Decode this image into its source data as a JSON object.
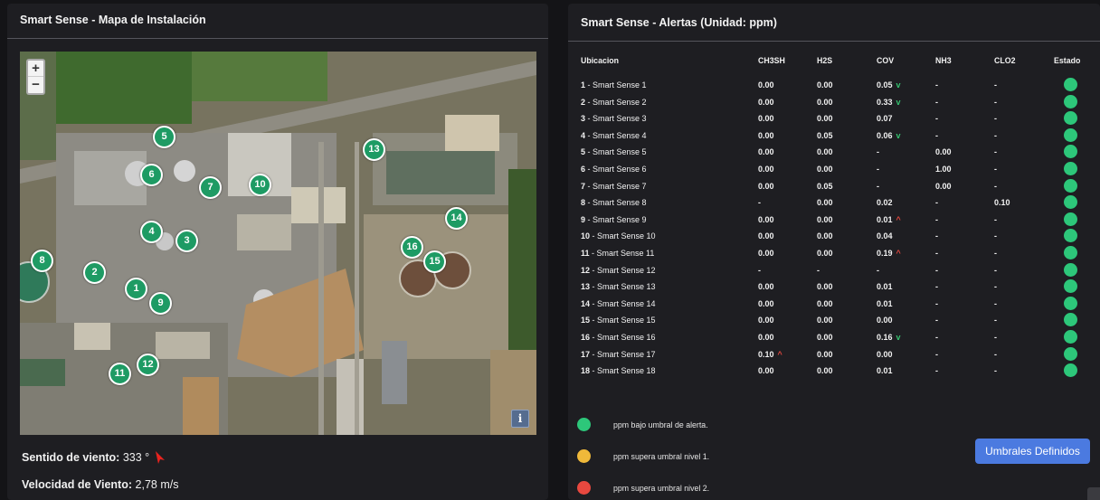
{
  "map_panel": {
    "title": "Smart Sense - Mapa de Instalación",
    "zoom_in": "+",
    "zoom_out": "−",
    "info": "i",
    "markers": [
      "1",
      "2",
      "3",
      "4",
      "5",
      "6",
      "7",
      "8",
      "9",
      "10",
      "11",
      "12",
      "13",
      "14",
      "15",
      "16"
    ],
    "wind_dir_label": "Sentido de viento:",
    "wind_dir_value": "333 °",
    "wind_speed_label": "Velocidad de Viento:",
    "wind_speed_value": "2,78 m/s",
    "wind_arrow_color": "#e8231e"
  },
  "alerts_panel": {
    "title": "Smart Sense - Alertas (Unidad: ppm)",
    "headers": [
      "Ubicacion",
      "CH3SH",
      "H2S",
      "COV",
      "NH3",
      "CLO2",
      "Estado"
    ],
    "rows": [
      {
        "num": "1",
        "name": " - Smart Sense 1",
        "ch3sh": "0.00",
        "h2s": "0.00",
        "cov": "0.05",
        "cov_trend": "v",
        "nh3": "-",
        "clo2": "-"
      },
      {
        "num": "2",
        "name": " - Smart Sense 2",
        "ch3sh": "0.00",
        "h2s": "0.00",
        "cov": "0.33",
        "cov_trend": "v",
        "nh3": "-",
        "clo2": "-"
      },
      {
        "num": "3",
        "name": " - Smart Sense 3",
        "ch3sh": "0.00",
        "h2s": "0.00",
        "cov": "0.07",
        "cov_trend": "",
        "nh3": "-",
        "clo2": "-"
      },
      {
        "num": "4",
        "name": " - Smart Sense 4",
        "ch3sh": "0.00",
        "h2s": "0.05",
        "cov": "0.06",
        "cov_trend": "v",
        "nh3": "-",
        "clo2": "-"
      },
      {
        "num": "5",
        "name": " - Smart Sense 5",
        "ch3sh": "0.00",
        "h2s": "0.00",
        "cov": "-",
        "cov_trend": "",
        "nh3": "0.00",
        "clo2": "-"
      },
      {
        "num": "6",
        "name": " - Smart Sense 6",
        "ch3sh": "0.00",
        "h2s": "0.00",
        "cov": "-",
        "cov_trend": "",
        "nh3": "1.00",
        "clo2": "-"
      },
      {
        "num": "7",
        "name": " - Smart Sense 7",
        "ch3sh": "0.00",
        "h2s": "0.05",
        "cov": "-",
        "cov_trend": "",
        "nh3": "0.00",
        "clo2": "-"
      },
      {
        "num": "8",
        "name": " - Smart Sense 8",
        "ch3sh": "-",
        "h2s": "0.00",
        "cov": "0.02",
        "cov_trend": "",
        "nh3": "-",
        "clo2": "0.10"
      },
      {
        "num": "9",
        "name": " - Smart Sense 9",
        "ch3sh": "0.00",
        "h2s": "0.00",
        "cov": "0.01",
        "cov_trend": "^",
        "nh3": "-",
        "clo2": "-"
      },
      {
        "num": "10",
        "name": " - Smart Sense 10",
        "ch3sh": "0.00",
        "h2s": "0.00",
        "cov": "0.04",
        "cov_trend": "",
        "nh3": "-",
        "clo2": "-"
      },
      {
        "num": "11",
        "name": " - Smart Sense 11",
        "ch3sh": "0.00",
        "h2s": "0.00",
        "cov": "0.19",
        "cov_trend": "^",
        "nh3": "-",
        "clo2": "-"
      },
      {
        "num": "12",
        "name": " - Smart Sense 12",
        "ch3sh": "-",
        "h2s": "-",
        "cov": "-",
        "cov_trend": "",
        "nh3": "-",
        "clo2": "-"
      },
      {
        "num": "13",
        "name": " - Smart Sense 13",
        "ch3sh": "0.00",
        "h2s": "0.00",
        "cov": "0.01",
        "cov_trend": "",
        "nh3": "-",
        "clo2": "-"
      },
      {
        "num": "14",
        "name": " - Smart Sense 14",
        "ch3sh": "0.00",
        "h2s": "0.00",
        "cov": "0.01",
        "cov_trend": "",
        "nh3": "-",
        "clo2": "-"
      },
      {
        "num": "15",
        "name": " - Smart Sense 15",
        "ch3sh": "0.00",
        "h2s": "0.00",
        "cov": "0.00",
        "cov_trend": "",
        "nh3": "-",
        "clo2": "-"
      },
      {
        "num": "16",
        "name": " - Smart Sense 16",
        "ch3sh": "0.00",
        "h2s": "0.00",
        "cov": "0.16",
        "cov_trend": "v",
        "nh3": "-",
        "clo2": "-"
      },
      {
        "num": "17",
        "name": " - Smart Sense 17",
        "ch3sh": "0.10",
        "ch3sh_trend": "^",
        "h2s": "0.00",
        "cov": "0.00",
        "cov_trend": "",
        "nh3": "-",
        "clo2": "-"
      },
      {
        "num": "18",
        "name": " - Smart Sense 18",
        "ch3sh": "0.00",
        "h2s": "0.00",
        "cov": "0.01",
        "cov_trend": "",
        "nh3": "-",
        "clo2": "-"
      }
    ],
    "status_color": "#2dc77a",
    "legend": [
      {
        "color": "#2dc77a",
        "text": "ppm bajo umbral de alerta."
      },
      {
        "color": "#f0b93a",
        "text": "ppm supera umbral nivel 1."
      },
      {
        "color": "#e8483f",
        "text": "ppm supera umbral nivel 2."
      }
    ],
    "button": "Umbrales Definidos"
  }
}
